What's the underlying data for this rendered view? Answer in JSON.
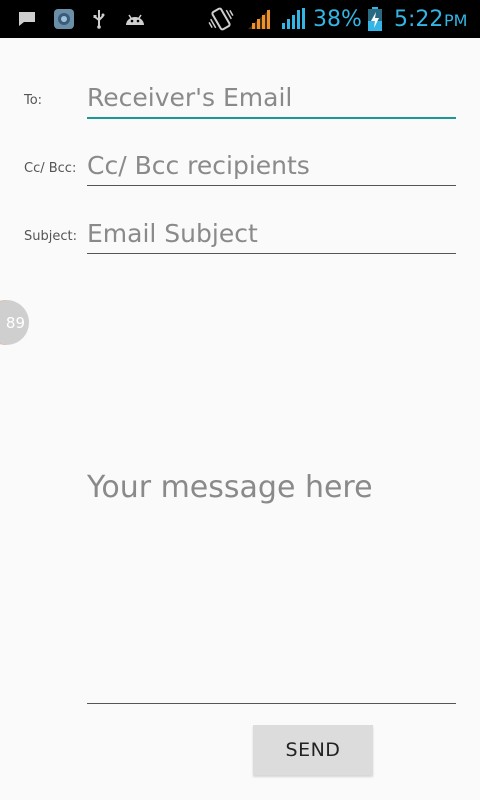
{
  "status_bar": {
    "battery_percent": "38%",
    "time": "5:22",
    "ampm": "PM",
    "accent_color": "#33b5e5",
    "left_icons": [
      "message-icon",
      "app-icon",
      "usb-icon",
      "android-debug-icon"
    ],
    "right_icons": [
      "vibrate-icon",
      "signal-orange-icon",
      "signal-blue-icon",
      "battery-charging-icon"
    ]
  },
  "form": {
    "to": {
      "label": "To:",
      "placeholder": "Receiver's Email"
    },
    "ccbcc": {
      "label": "Cc/ Bcc:",
      "placeholder": "Cc/ Bcc recipients"
    },
    "subject": {
      "label": "Subject:",
      "placeholder": "Email Subject"
    },
    "message": {
      "placeholder": "Your message here"
    },
    "send_label": "SEND",
    "focus_color": "#1a9a94"
  },
  "floating_bubble": {
    "count": "89",
    "accent": "#f08050"
  }
}
